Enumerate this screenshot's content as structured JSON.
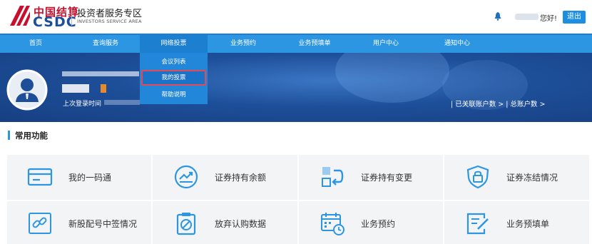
{
  "header": {
    "logo_cn": "中国结算",
    "logo_en": "CSDC",
    "area_title": "投资者服务专区",
    "area_subtitle": "INVESTORS SERVICE AREA",
    "greeting": "您好!",
    "logout_label": "退出"
  },
  "nav": {
    "items": [
      {
        "label": "首页"
      },
      {
        "label": "查询服务"
      },
      {
        "label": "网络投票"
      },
      {
        "label": "业务预约"
      },
      {
        "label": "业务预填单"
      },
      {
        "label": "用户中心"
      },
      {
        "label": "通知中心"
      }
    ],
    "active": "网络投票"
  },
  "dropdown": {
    "items": [
      {
        "label": "会议列表"
      },
      {
        "label": "我的投票"
      },
      {
        "label": "帮助说明"
      }
    ],
    "selected": "我的投票"
  },
  "profile": {
    "last_login_label": "上次登录时间",
    "accounts_text": "| 已关联账户数 > | 总账户数 >"
  },
  "section": {
    "title": "常用功能"
  },
  "functions": [
    {
      "label": "我的一码通",
      "icon": "card-icon"
    },
    {
      "label": "证券持有余额",
      "icon": "trend-chart-icon"
    },
    {
      "label": "证券持有变更",
      "icon": "swap-icon"
    },
    {
      "label": "证券冻结情况",
      "icon": "lock-shield-icon"
    },
    {
      "label": "新股配号中签情况",
      "icon": "link-icon"
    },
    {
      "label": "放弃认购数据",
      "icon": "clipboard-cancel-icon"
    },
    {
      "label": "业务预约",
      "icon": "calendar-clock-icon"
    },
    {
      "label": "业务预填单",
      "icon": "form-edit-icon"
    }
  ],
  "colors": {
    "nav_blue": "#2d96e3",
    "brand_red": "#c8102e",
    "brand_blue": "#1a4f9c",
    "highlight_red": "#e24a55"
  }
}
